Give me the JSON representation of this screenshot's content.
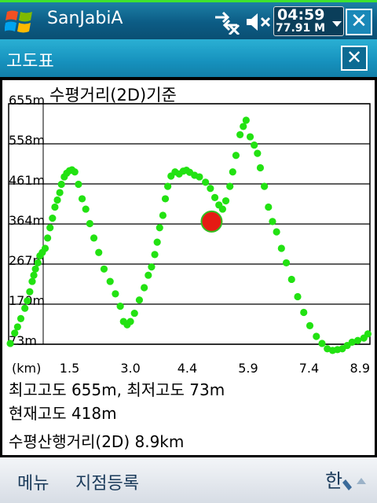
{
  "statusbar": {
    "app_title": "SanJabiA",
    "time": "04:59",
    "memory": "77.91 M"
  },
  "dialog": {
    "title": "고도표",
    "close_label": "✕"
  },
  "chart_data": {
    "type": "scatter",
    "title": "수평거리(2D)기준",
    "xlabel": "(km)",
    "x_ticks": [
      "1.5",
      "3.0",
      "4.4",
      "5.9",
      "7.4",
      "8.9"
    ],
    "y_ticks": [
      "655m",
      "558m",
      "461m",
      "364m",
      "267m",
      "170m",
      "73m"
    ],
    "xlim": [
      0,
      8.9
    ],
    "ylim": [
      73,
      655
    ],
    "grid": true,
    "series": [
      {
        "color": "#22e212",
        "points": [
          [
            0.04,
            75
          ],
          [
            0.15,
            100
          ],
          [
            0.22,
            115
          ],
          [
            0.3,
            135
          ],
          [
            0.4,
            160
          ],
          [
            0.46,
            178
          ],
          [
            0.52,
            200
          ],
          [
            0.58,
            225
          ],
          [
            0.62,
            240
          ],
          [
            0.66,
            255
          ],
          [
            0.72,
            270
          ],
          [
            0.77,
            287
          ],
          [
            0.83,
            295
          ],
          [
            0.9,
            305
          ],
          [
            0.96,
            330
          ],
          [
            1.02,
            355
          ],
          [
            1.08,
            378
          ],
          [
            1.14,
            405
          ],
          [
            1.2,
            422
          ],
          [
            1.26,
            440
          ],
          [
            1.3,
            460
          ],
          [
            1.37,
            478
          ],
          [
            1.43,
            487
          ],
          [
            1.5,
            493
          ],
          [
            1.56,
            495
          ],
          [
            1.63,
            490
          ],
          [
            1.72,
            460
          ],
          [
            1.81,
            425
          ],
          [
            1.9,
            400
          ],
          [
            2.0,
            365
          ],
          [
            2.1,
            330
          ],
          [
            2.22,
            295
          ],
          [
            2.35,
            255
          ],
          [
            2.5,
            225
          ],
          [
            2.63,
            195
          ],
          [
            2.75,
            165
          ],
          [
            2.83,
            128
          ],
          [
            2.92,
            120
          ],
          [
            3.0,
            128
          ],
          [
            3.1,
            148
          ],
          [
            3.22,
            180
          ],
          [
            3.34,
            210
          ],
          [
            3.44,
            240
          ],
          [
            3.52,
            260
          ],
          [
            3.6,
            290
          ],
          [
            3.66,
            320
          ],
          [
            3.72,
            355
          ],
          [
            3.8,
            385
          ],
          [
            3.86,
            425
          ],
          [
            3.92,
            455
          ],
          [
            4.0,
            480
          ],
          [
            4.1,
            490
          ],
          [
            4.2,
            485
          ],
          [
            4.3,
            492
          ],
          [
            4.38,
            494
          ],
          [
            4.46,
            489
          ],
          [
            4.58,
            482
          ],
          [
            4.7,
            478
          ],
          [
            4.85,
            465
          ],
          [
            4.97,
            450
          ],
          [
            5.08,
            428
          ],
          [
            5.18,
            410
          ],
          [
            5.27,
            400
          ],
          [
            5.35,
            420
          ],
          [
            5.45,
            455
          ],
          [
            5.52,
            490
          ],
          [
            5.6,
            530
          ],
          [
            5.7,
            580
          ],
          [
            5.78,
            600
          ],
          [
            5.85,
            615
          ],
          [
            5.95,
            575
          ],
          [
            6.05,
            555
          ],
          [
            6.13,
            535
          ],
          [
            6.2,
            500
          ],
          [
            6.3,
            455
          ],
          [
            6.4,
            405
          ],
          [
            6.5,
            370
          ],
          [
            6.6,
            345
          ],
          [
            6.72,
            305
          ],
          [
            6.84,
            270
          ],
          [
            6.97,
            230
          ],
          [
            7.12,
            188
          ],
          [
            7.27,
            150
          ],
          [
            7.42,
            118
          ],
          [
            7.58,
            92
          ],
          [
            7.72,
            75
          ],
          [
            7.85,
            62
          ],
          [
            7.98,
            58
          ],
          [
            8.1,
            60
          ],
          [
            8.22,
            62
          ],
          [
            8.34,
            70
          ],
          [
            8.46,
            78
          ],
          [
            8.6,
            82
          ],
          [
            8.75,
            88
          ],
          [
            8.85,
            98
          ]
        ]
      }
    ],
    "current_point": {
      "x": 5.0,
      "y": 370,
      "color": "#e51a14"
    }
  },
  "stats": {
    "max_min": "최고고도 655m, 최저고도 73m",
    "current": "현재고도 418m",
    "distance": "수평산행거리(2D)  8.9km"
  },
  "menu": {
    "left": "메뉴",
    "right": "지점등록"
  }
}
